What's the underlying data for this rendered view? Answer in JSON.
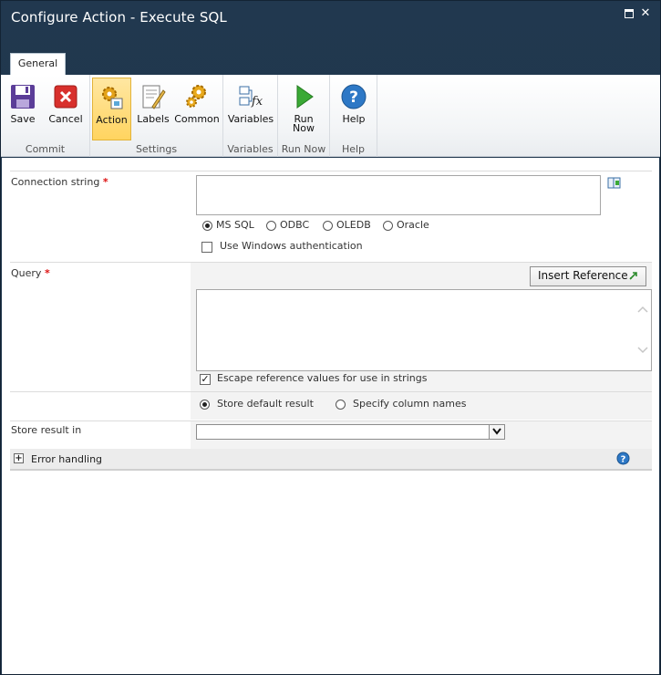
{
  "window": {
    "title": "Configure Action - Execute SQL"
  },
  "tabs": [
    {
      "label": "General"
    }
  ],
  "ribbon": {
    "groups": [
      {
        "label": "Commit",
        "buttons": [
          {
            "label": "Save",
            "icon": "save-floppy-icon"
          },
          {
            "label": "Cancel",
            "icon": "cancel-icon"
          }
        ]
      },
      {
        "label": "Settings",
        "buttons": [
          {
            "label": "Action",
            "icon": "action-gears-icon",
            "selected": true
          },
          {
            "label": "Labels",
            "icon": "labels-icon"
          },
          {
            "label": "Common",
            "icon": "common-gears-icon"
          }
        ]
      },
      {
        "label": "Variables",
        "buttons": [
          {
            "label": "Variables",
            "icon": "variables-fx-icon"
          }
        ]
      },
      {
        "label": "Run Now",
        "buttons": [
          {
            "label_line1": "Run",
            "label_line2": "Now",
            "icon": "run-play-icon"
          }
        ]
      },
      {
        "label": "Help",
        "buttons": [
          {
            "label": "Help",
            "icon": "help-icon"
          }
        ]
      }
    ]
  },
  "form": {
    "connection": {
      "label": "Connection string",
      "required_mark": "*",
      "value": "",
      "providers": [
        "MS SQL",
        "ODBC",
        "OLEDB",
        "Oracle"
      ],
      "selected_provider": "MS SQL",
      "windows_auth_label": "Use Windows authentication",
      "windows_auth_checked": false
    },
    "query": {
      "label": "Query",
      "required_mark": "*",
      "insert_reference_label": "Insert Reference",
      "value": "",
      "escape_label": "Escape reference values for use in strings",
      "escape_checked": true
    },
    "result_mode": {
      "options": [
        "Store default result",
        "Specify column names"
      ],
      "selected": "Store default result"
    },
    "store_result": {
      "label": "Store result in",
      "value": ""
    },
    "error_handling": {
      "expander": "+",
      "label": "Error handling"
    }
  },
  "colors": {
    "title_bar": "#21384f",
    "selected_button": "#ffd460",
    "required": "#dd1111"
  }
}
